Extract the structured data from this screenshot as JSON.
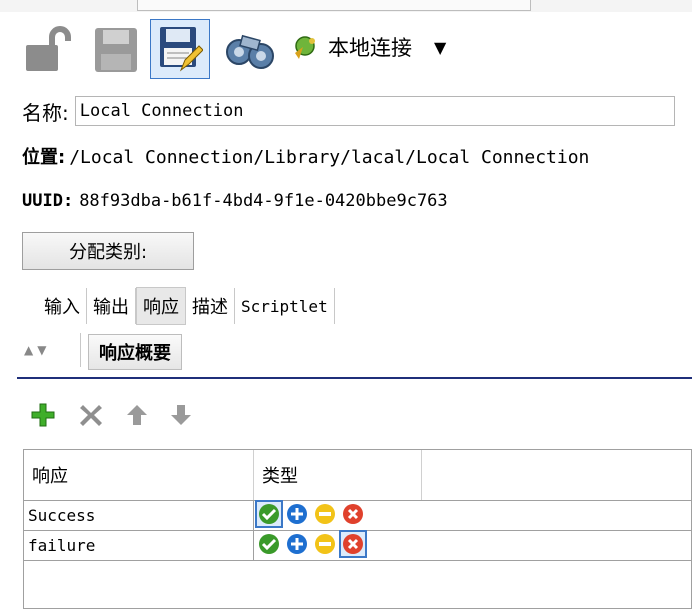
{
  "toolbar": {
    "connection_label": "本地连接"
  },
  "fields": {
    "name_label": "名称:",
    "name_value": "Local Connection",
    "location_label": "位置:",
    "location_value": "/Local Connection/Library/lacal/Local Connection",
    "uuid_label": "UUID:",
    "uuid_value": "88f93dba-b61f-4bd4-9f1e-0420bbe9c763"
  },
  "assign_button": "分配类别:",
  "tabs": [
    {
      "label": "输入"
    },
    {
      "label": "输出"
    },
    {
      "label": "响应"
    },
    {
      "label": "描述"
    },
    {
      "label": "Scriptlet"
    }
  ],
  "subtab": "响应概要",
  "table": {
    "headers": [
      "响应",
      "类型"
    ],
    "rows": [
      {
        "name": "Success",
        "selected_icon": "success"
      },
      {
        "name": "failure",
        "selected_icon": "error"
      }
    ]
  },
  "icons": {
    "type_options": [
      "success-icon",
      "info-icon",
      "warning-icon",
      "error-icon"
    ]
  },
  "colors": {
    "accent": "#3b78c7",
    "divider": "#1f2f7a",
    "add_green": "#3fae2a"
  }
}
